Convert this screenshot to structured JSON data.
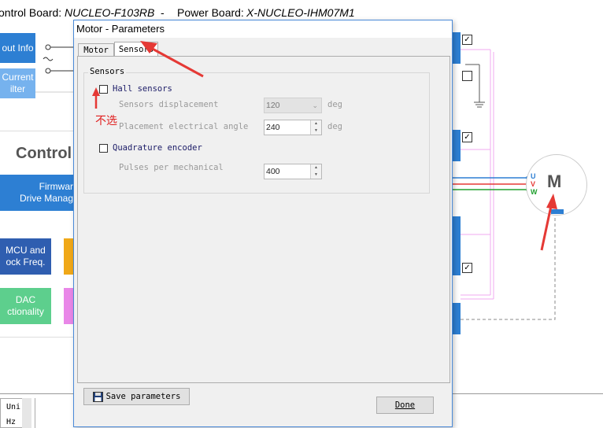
{
  "topbar": {
    "control_board_label": "ontrol Board:",
    "control_board_value": "NUCLEO-F103RB",
    "separator": "-",
    "power_board_label": "Power Board:",
    "power_board_value": "X-NUCLEO-IHM07M1"
  },
  "background": {
    "btn_input_info": "out Info",
    "btn_current_filter": "Current\nilter",
    "control_heading": "Control",
    "btn_firmware": "Firmwar\nDrive Manag",
    "btn_mcu_clock": "MCU and\nock Freq.",
    "btn_dac": "DAC\nctionality",
    "motor_letter": "M",
    "phase_u": "U",
    "phase_v": "V",
    "phase_w": "W",
    "bottom_units": "Uni",
    "bottom_hz": "Hz"
  },
  "dialog": {
    "title": "Motor - Parameters",
    "tabs": [
      {
        "label": "Motor"
      },
      {
        "label": "Sensors"
      }
    ],
    "group_title": "Sensors",
    "hall_sensors_label": "Hall sensors",
    "sensors_displacement_label": "Sensors displacement",
    "sensors_displacement_value": "120",
    "sensors_displacement_unit": "deg",
    "placement_angle_label": "Placement electrical angle",
    "placement_angle_value": "240",
    "placement_angle_unit": "deg",
    "quadrature_label": "Quadrature encoder",
    "pulses_label": "Pulses per mechanical",
    "pulses_value": "400",
    "save_button": "Save parameters",
    "done_button": "Done"
  },
  "annotation": {
    "hint_text": "不选",
    "color": "#e53935"
  },
  "colors": {
    "blue_tile": "#2d7fd3",
    "light_blue_tile": "#76b2ee",
    "navy_tile": "#2f5eb0",
    "green_tile": "#5dcf8d",
    "orange_tile": "#f0a818",
    "pink_tile": "#e987e8",
    "dialog_border": "#4a8ad8"
  }
}
